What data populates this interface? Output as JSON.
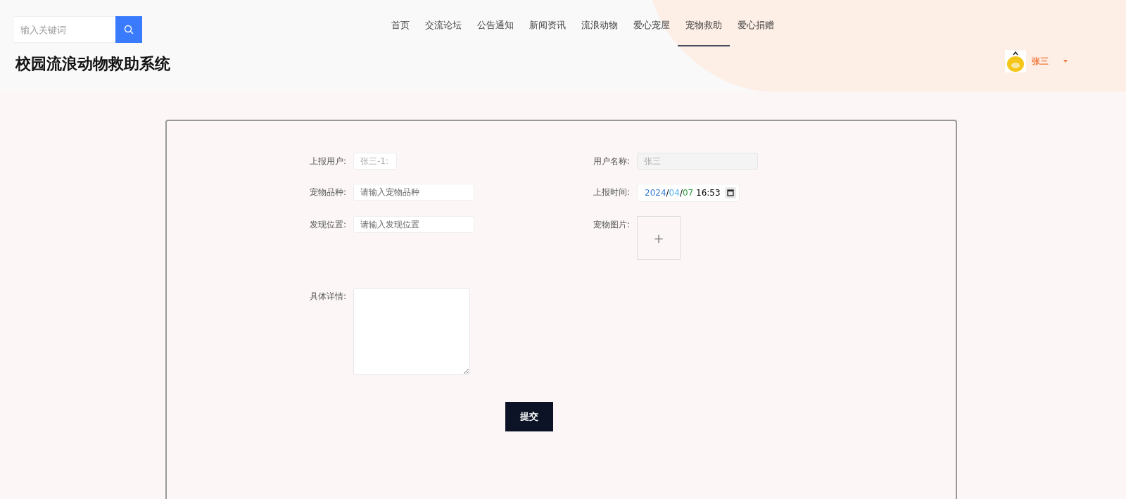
{
  "search": {
    "placeholder": "输入关键词"
  },
  "nav": [
    {
      "label": "首页",
      "selected": false
    },
    {
      "label": "交流论坛",
      "selected": false
    },
    {
      "label": "公告通知",
      "selected": false
    },
    {
      "label": "新闻资讯",
      "selected": false
    },
    {
      "label": "流浪动物",
      "selected": false
    },
    {
      "label": "爱心宠屋",
      "selected": false
    },
    {
      "label": "宠物救助",
      "selected": true
    },
    {
      "label": "爱心捐赠",
      "selected": false
    }
  ],
  "site_title": "校园流浪动物救助系统",
  "user": {
    "name": "张三"
  },
  "form": {
    "fields": [
      {
        "kind": "short",
        "label": "上报用户:",
        "value": "张三-1:"
      },
      {
        "kind": "disabled",
        "label": "用户名称:",
        "value": "张三"
      },
      {
        "kind": "text",
        "label": "宠物品种:",
        "placeholder": "请输入宠物品种"
      },
      {
        "kind": "datetime",
        "label": "上报时间:",
        "value": "2024/04/07 16:53"
      },
      {
        "kind": "text",
        "label": "发现位置:",
        "placeholder": "请输入发现位置"
      },
      {
        "kind": "upload",
        "label": "宠物图片:",
        "button": "+"
      },
      {
        "kind": "textarea",
        "label": "具体详情:"
      }
    ],
    "submit": "提交"
  }
}
